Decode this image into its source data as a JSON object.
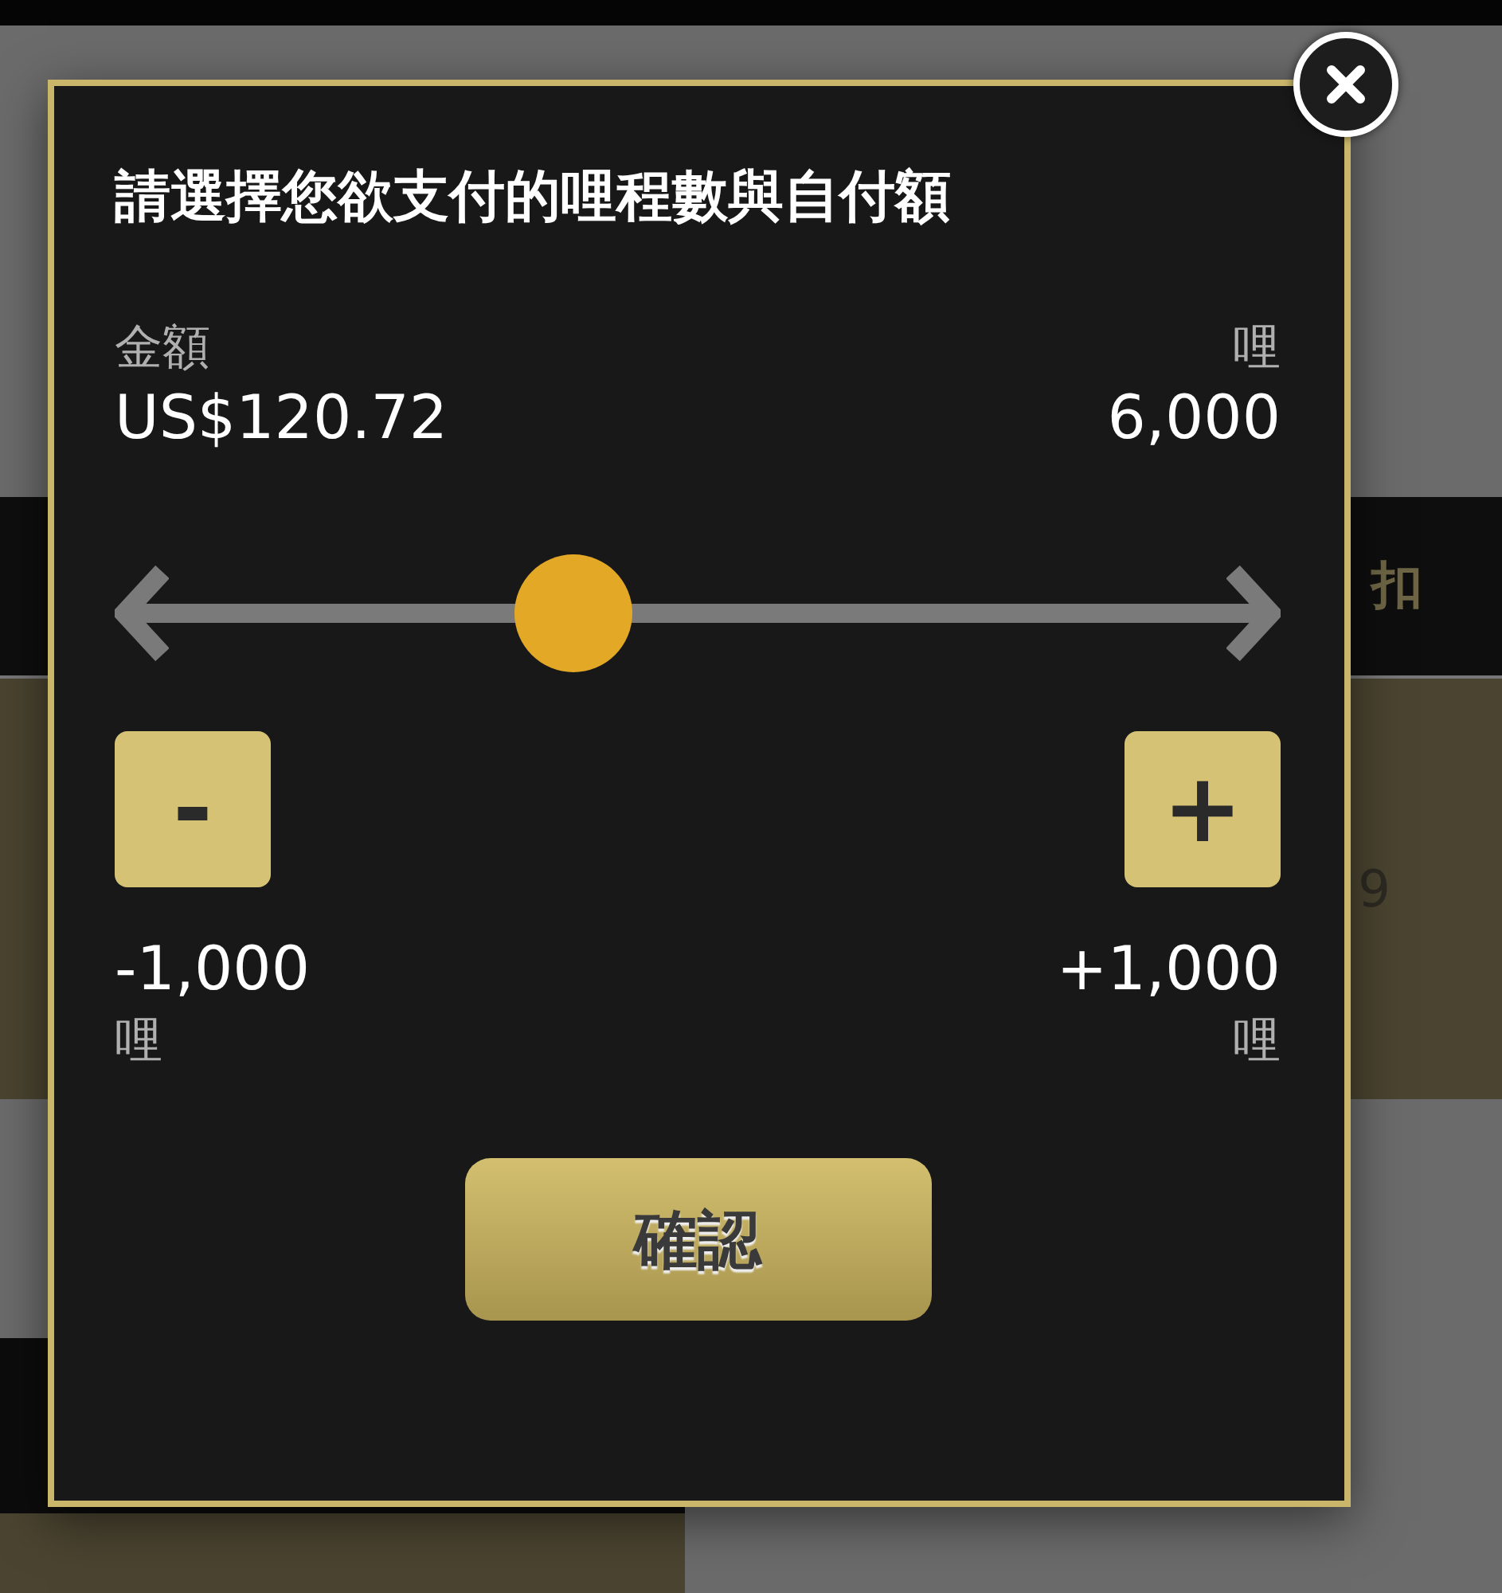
{
  "background": {
    "header_text": "扣",
    "row_text": "9"
  },
  "dialog": {
    "title": "請選擇您欲支付的哩程數與自付額",
    "amount": {
      "label": "金額",
      "value": "US$120.72"
    },
    "miles": {
      "label": "哩",
      "value": "6,000"
    },
    "slider": {
      "level": 0.39
    },
    "steps": [
      {
        "kind": "minus",
        "symbol": "-",
        "amount": "-1,000",
        "unit": "哩"
      },
      {
        "kind": "plus",
        "symbol": "+",
        "amount": "+1,000",
        "unit": "哩"
      }
    ],
    "confirm": "確認"
  }
}
